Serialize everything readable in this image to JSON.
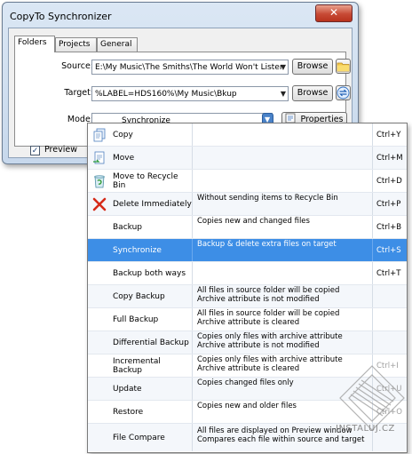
{
  "window": {
    "title": "CopyTo Synchronizer",
    "close_label": "✕"
  },
  "tabs": [
    {
      "label": "Folders"
    },
    {
      "label": "Projects"
    },
    {
      "label": "General"
    }
  ],
  "form": {
    "source_label": "Source:",
    "source_value": "E:\\My Music\\The Smiths\\The World Won't Lister",
    "target_label": "Target:",
    "target_value": "%LABEL=HDS160%\\My Music\\Bkup",
    "mode_label": "Mode:",
    "mode_value": "Synchronize",
    "browse_label": "Browse",
    "properties_label": "Properties",
    "preview_label": "Preview",
    "preview_checked": true
  },
  "mode_options": [
    {
      "name": "Copy",
      "icon": "copy-icon",
      "desc1": "",
      "desc2": "",
      "key": "Ctrl+Y"
    },
    {
      "name": "Move",
      "icon": "move-icon",
      "desc1": "",
      "desc2": "",
      "key": "Ctrl+M"
    },
    {
      "name": "Move to Recycle Bin",
      "icon": "recycle-bin-icon",
      "desc1": "",
      "desc2": "",
      "key": "Ctrl+D"
    },
    {
      "name": "Delete Immediately",
      "icon": "delete-icon",
      "desc1": "Without sending items to Recycle Bin",
      "desc2": "",
      "key": "Ctrl+P"
    },
    {
      "name": "Backup",
      "icon": "",
      "desc1": "Copies new and changed files",
      "desc2": "",
      "key": "Ctrl+B"
    },
    {
      "name": "Synchronize",
      "icon": "",
      "desc1": "Backup & delete extra files on target",
      "desc2": "",
      "key": "Ctrl+S"
    },
    {
      "name": "Backup both ways",
      "icon": "",
      "desc1": "",
      "desc2": "",
      "key": "Ctrl+T"
    },
    {
      "name": "Copy Backup",
      "icon": "",
      "desc1": "All files in source folder will be copied",
      "desc2": "Archive attribute is not modified",
      "key": ""
    },
    {
      "name": "Full Backup",
      "icon": "",
      "desc1": "All files in source folder will be copied",
      "desc2": "Archive attribute is cleared",
      "key": ""
    },
    {
      "name": "Differential Backup",
      "icon": "",
      "desc1": "Copies only files with archive attribute",
      "desc2": "Archive attribute is not modified",
      "key": ""
    },
    {
      "name": "Incremental Backup",
      "icon": "",
      "desc1": "Copies only files with archive attribute",
      "desc2": "Archive attribute is cleared",
      "key": "Ctrl+I"
    },
    {
      "name": "Update",
      "icon": "",
      "desc1": "Copies changed files only",
      "desc2": "",
      "key": "Ctrl+U"
    },
    {
      "name": "Restore",
      "icon": "",
      "desc1": "Copies new and older files",
      "desc2": "",
      "key": "Ctrl+O"
    },
    {
      "name": "File Compare",
      "icon": "",
      "desc1": "All files are displayed on Preview window",
      "desc2": "Compares each file within source and target",
      "key": ""
    }
  ],
  "selected_option": "Synchronize",
  "watermark": {
    "text": "INSTALUJ.CZ"
  },
  "colors": {
    "selection": "#3d8ee6",
    "title_bar": "#c7d8ec",
    "close_button": "#c74a35"
  }
}
